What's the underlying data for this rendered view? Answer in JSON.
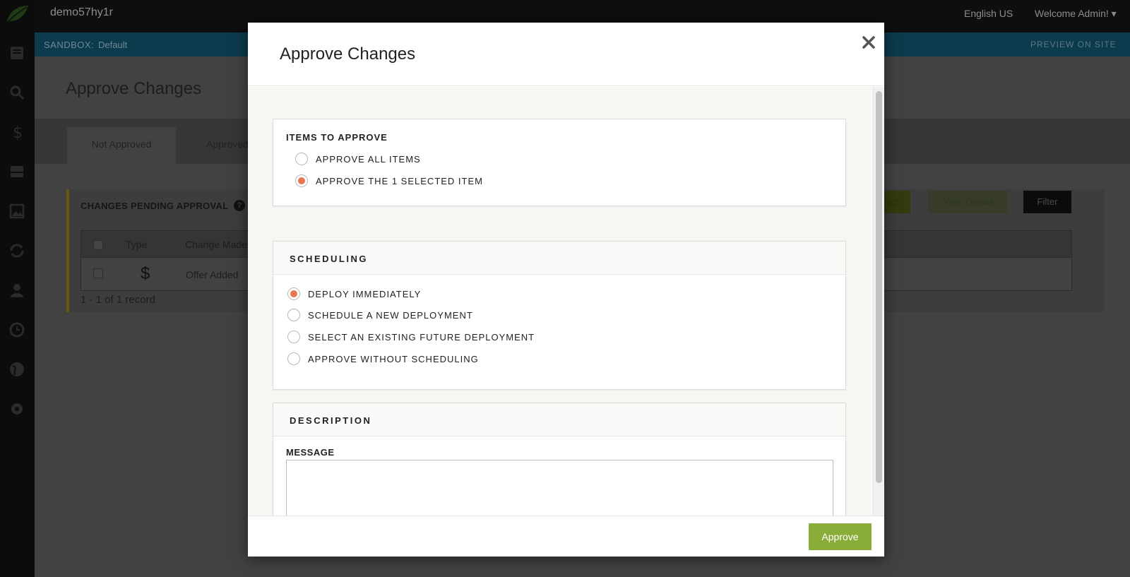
{
  "app": {
    "site_name": "demo57hy1r",
    "language": "English US",
    "welcome": "Welcome Admin! ▾"
  },
  "sandbox": {
    "label": "SANDBOX:",
    "value": "Default",
    "preview_link": "PREVIEW ON SITE"
  },
  "sidebar": {
    "icons": [
      "logo-leaf-icon",
      "content-icon",
      "search-icon",
      "pricing-icon",
      "catalog-icon",
      "media-icon",
      "sync-icon",
      "user-icon",
      "history-icon",
      "globe-icon",
      "settings-icon"
    ]
  },
  "page": {
    "title": "Approve Changes",
    "tabs": [
      {
        "label": "Not Approved",
        "active": true
      },
      {
        "label": "Approved",
        "active": false
      }
    ]
  },
  "pending": {
    "title": "CHANGES PENDING APPROVAL",
    "buttons": {
      "reject": "Reject",
      "view_details": "View Details",
      "filter": "Filter"
    },
    "columns": [
      "Type",
      "Change Made"
    ],
    "rows": [
      {
        "type_icon": "$",
        "change": "Offer Added"
      }
    ],
    "record_count": "1 - 1 of 1 record"
  },
  "modal": {
    "title": "Approve Changes",
    "items_section": {
      "heading": "ITEMS TO APPROVE",
      "options": [
        {
          "label": "APPROVE ALL ITEMS",
          "checked": false
        },
        {
          "label": "APPROVE THE 1 SELECTED ITEM",
          "checked": true
        }
      ]
    },
    "scheduling_section": {
      "heading": "SCHEDULING",
      "options": [
        {
          "label": "DEPLOY IMMEDIATELY",
          "checked": true
        },
        {
          "label": "SCHEDULE A NEW DEPLOYMENT",
          "checked": false
        },
        {
          "label": "SELECT AN EXISTING FUTURE DEPLOYMENT",
          "checked": false
        },
        {
          "label": "APPROVE WITHOUT SCHEDULING",
          "checked": false
        }
      ]
    },
    "description_section": {
      "heading": "DESCRIPTION",
      "message_label": "MESSAGE",
      "message_value": ""
    },
    "approve_button": "Approve"
  },
  "colors": {
    "accent_radio": "#e7774e",
    "approve_button": "#8aac38",
    "sandbox_bar": "#0c3b4d",
    "sidebar": "#0c0c0c"
  }
}
